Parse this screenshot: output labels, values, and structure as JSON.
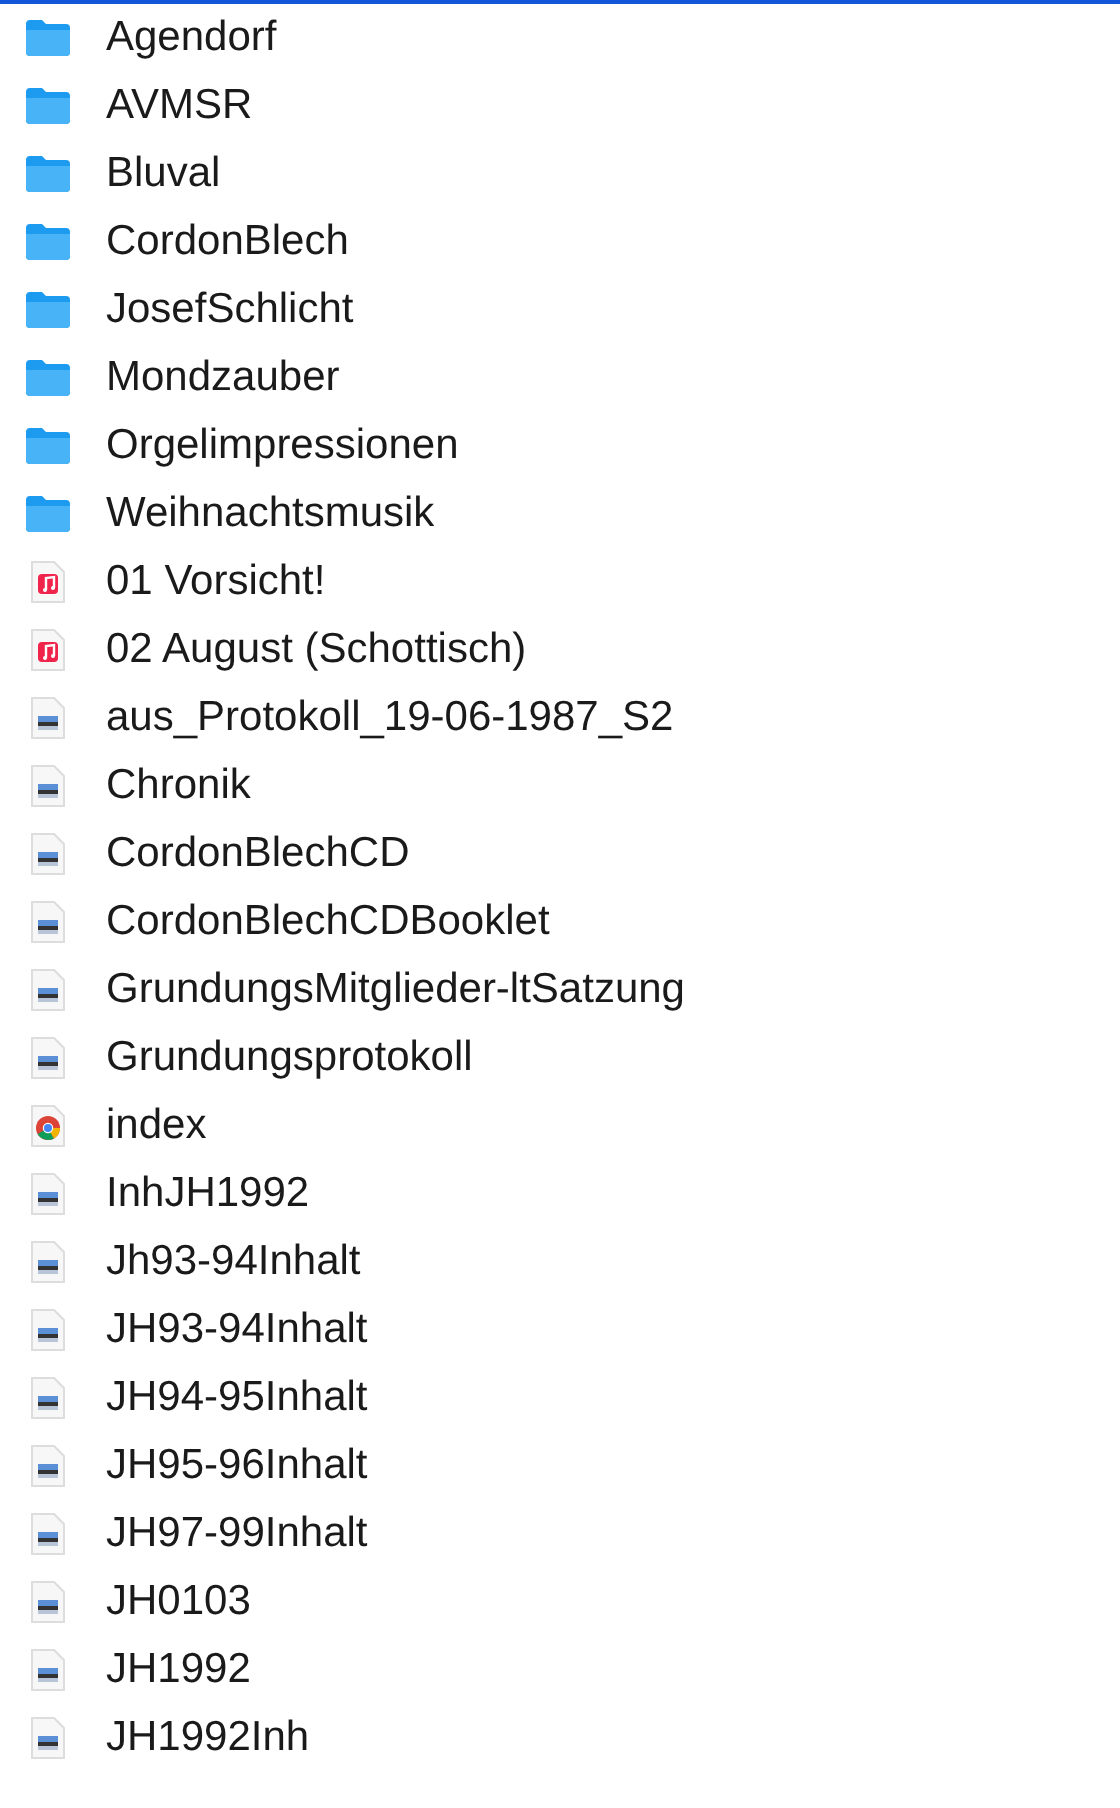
{
  "files": [
    {
      "name": "Agendorf",
      "kind": "folder"
    },
    {
      "name": "AVMSR",
      "kind": "folder"
    },
    {
      "name": "Bluval",
      "kind": "folder"
    },
    {
      "name": "CordonBlech",
      "kind": "folder"
    },
    {
      "name": "JosefSchlicht",
      "kind": "folder"
    },
    {
      "name": "Mondzauber",
      "kind": "folder"
    },
    {
      "name": "Orgelimpressionen",
      "kind": "folder"
    },
    {
      "name": "Weihnachtsmusik",
      "kind": "folder"
    },
    {
      "name": "01 Vorsicht!",
      "kind": "audio"
    },
    {
      "name": "02 August (Schottisch)",
      "kind": "audio"
    },
    {
      "name": "aus_Protokoll_19-06-1987_S2",
      "kind": "document"
    },
    {
      "name": "Chronik",
      "kind": "document"
    },
    {
      "name": "CordonBlechCD",
      "kind": "document"
    },
    {
      "name": "CordonBlechCDBooklet",
      "kind": "document"
    },
    {
      "name": "GrundungsMitglieder-ltSatzung",
      "kind": "document"
    },
    {
      "name": "Grundungsprotokoll",
      "kind": "document"
    },
    {
      "name": "index",
      "kind": "web"
    },
    {
      "name": "InhJH1992",
      "kind": "document"
    },
    {
      "name": "Jh93-94Inhalt",
      "kind": "document"
    },
    {
      "name": "JH93-94Inhalt",
      "kind": "document"
    },
    {
      "name": "JH94-95Inhalt",
      "kind": "document"
    },
    {
      "name": "JH95-96Inhalt",
      "kind": "document"
    },
    {
      "name": "JH97-99Inhalt",
      "kind": "document"
    },
    {
      "name": "JH0103",
      "kind": "document"
    },
    {
      "name": "JH1992",
      "kind": "document"
    },
    {
      "name": "JH1992Inh",
      "kind": "document"
    }
  ]
}
